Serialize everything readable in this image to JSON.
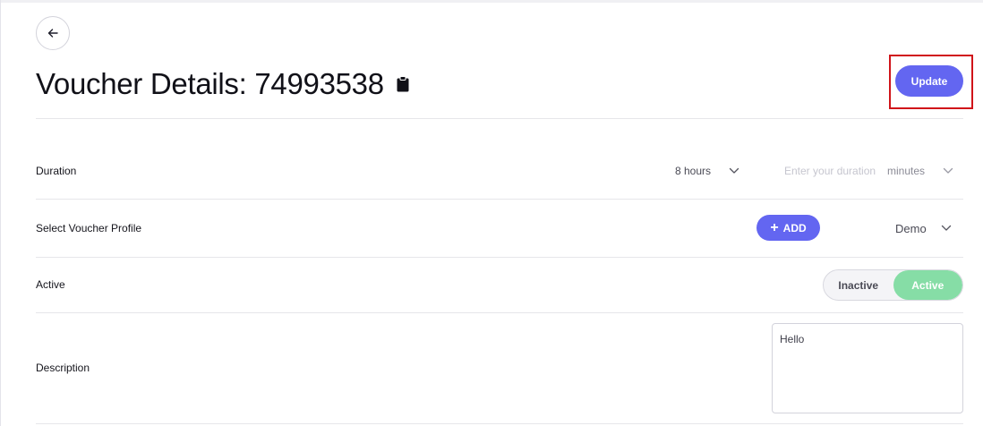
{
  "header": {
    "title": "Voucher Details: 74993538",
    "update_label": "Update",
    "back_icon": "arrow-left-icon",
    "copy_icon": "clipboard-icon"
  },
  "rows": {
    "duration": {
      "label": "Duration",
      "hours_value": "8 hours",
      "minutes_placeholder": "Enter your duration",
      "minutes_unit": "minutes"
    },
    "profile": {
      "label": "Select Voucher Profile",
      "add_label": "ADD",
      "selected": "Demo"
    },
    "active": {
      "label": "Active",
      "inactive_label": "Inactive",
      "active_label": "Active",
      "selected": "Active"
    },
    "description": {
      "label": "Description",
      "value": "Hello"
    }
  },
  "colors": {
    "accent": "#6366f1",
    "active_green": "#86dda6",
    "highlight": "#d0141a"
  }
}
